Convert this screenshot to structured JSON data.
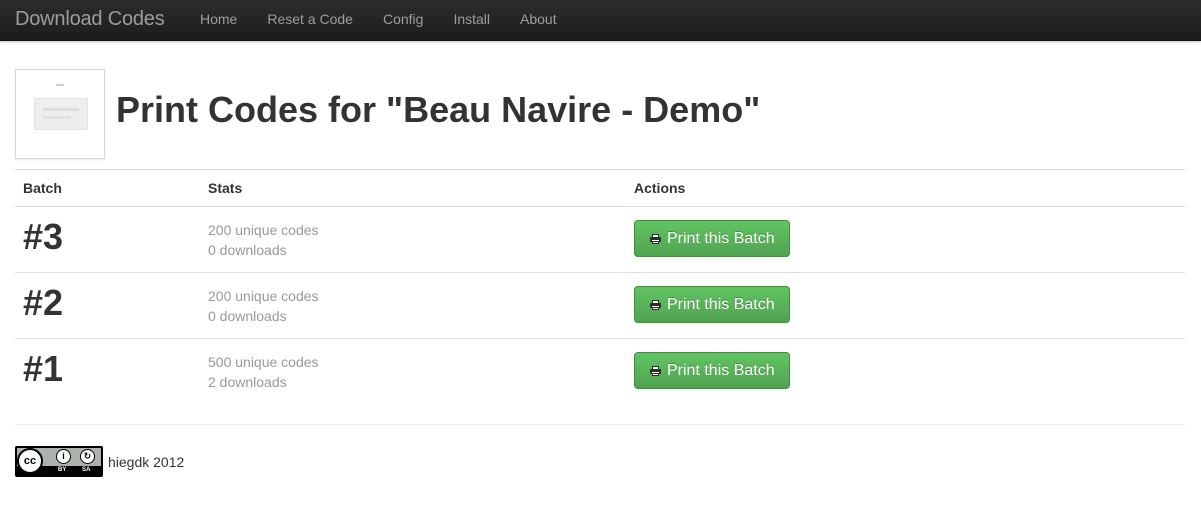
{
  "navbar": {
    "brand": "Download Codes",
    "links": [
      "Home",
      "Reset a Code",
      "Config",
      "Install",
      "About"
    ]
  },
  "header": {
    "title": "Print Codes for \"Beau Navire - Demo\""
  },
  "table": {
    "headers": [
      "Batch",
      "Stats",
      "Actions"
    ],
    "rows": [
      {
        "batch": "#3",
        "codes": "200 unique codes",
        "downloads": "0 downloads",
        "action": "Print this Batch"
      },
      {
        "batch": "#2",
        "codes": "200 unique codes",
        "downloads": "0 downloads",
        "action": "Print this Batch"
      },
      {
        "batch": "#1",
        "codes": "500 unique codes",
        "downloads": "2 downloads",
        "action": "Print this Batch"
      }
    ]
  },
  "footer": {
    "license_badge": {
      "cc": "cc",
      "by": "BY",
      "sa": "SA"
    },
    "text": "hiegdk 2012"
  },
  "colors": {
    "navbar_bg": "#222222",
    "button_green": "#51a351",
    "muted_text": "#999999"
  },
  "icons": [
    "print-icon",
    "cc-by-sa-license-icon"
  ]
}
